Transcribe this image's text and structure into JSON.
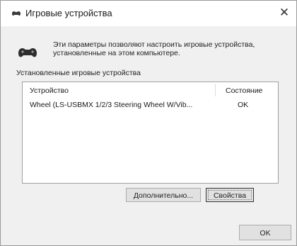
{
  "window": {
    "title": "Игровые устройства",
    "close_glyph": "✕"
  },
  "header": {
    "description": "Эти параметры позволяют настроить игровые устройства, установленные на этом компьютере.",
    "icon": "gamepad-icon"
  },
  "devices": {
    "group_label": "Установленные игровые устройства",
    "columns": [
      "Устройство",
      "Состояние"
    ],
    "rows": [
      {
        "device": "Wheel (LS-USBMX 1/2/3 Steering Wheel W/Vib...",
        "status": "OK"
      }
    ]
  },
  "buttons": {
    "advanced": "Дополнительно...",
    "properties": "Свойства",
    "ok": "OK"
  },
  "colors": {
    "window_bg": "#ffffff",
    "client_bg": "#f0f0f0",
    "button_bg": "#e1e1e1",
    "border": "#adadad"
  }
}
